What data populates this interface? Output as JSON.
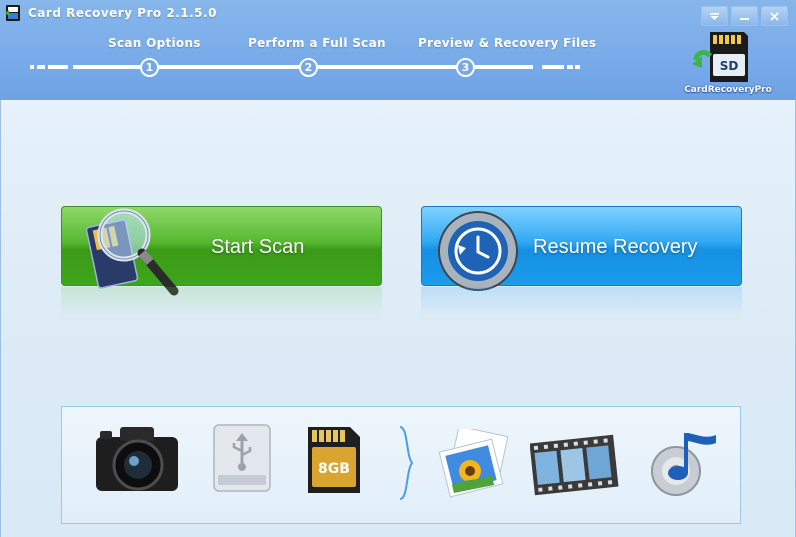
{
  "window": {
    "title": "Card Recovery Pro 2.1.5.0",
    "controls": {
      "menu": "menu",
      "minimize": "minimize",
      "close": "close"
    }
  },
  "steps": [
    {
      "number": "1",
      "label": "Scan Options"
    },
    {
      "number": "2",
      "label": "Perform a Full Scan"
    },
    {
      "number": "3",
      "label": "Preview & Recovery Files"
    }
  ],
  "brand": {
    "text": "CardRecoveryPro",
    "card_label": "SD"
  },
  "actions": {
    "start_scan": "Start Scan",
    "resume_recovery": "Resume Recovery"
  },
  "sd_card_capacity": "8GB",
  "icons": [
    "camera-icon",
    "usb-drive-icon",
    "sd-card-icon",
    "brace-icon",
    "photo-icon",
    "film-icon",
    "music-icon"
  ],
  "colors": {
    "header": "#7aacea",
    "start_scan": "#4caf2a",
    "resume_recovery": "#1f9de9",
    "background": "#dcecf8"
  }
}
